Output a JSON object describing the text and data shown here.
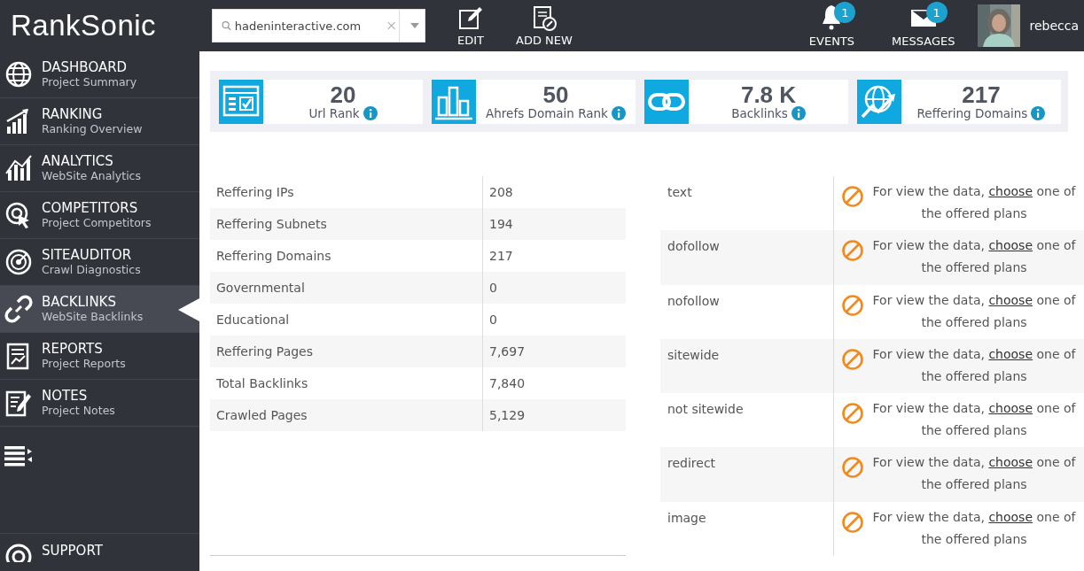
{
  "logo": {
    "text": "RankSonic"
  },
  "search": {
    "value": "hadeninteractive.com"
  },
  "toolbar": [
    {
      "kind": "edit",
      "label": "EDIT"
    },
    {
      "kind": "add",
      "label": "ADD NEW"
    }
  ],
  "notifications": [
    {
      "kind": "events",
      "label": "EVENTS",
      "count": "1"
    },
    {
      "kind": "messages",
      "label": "MESSAGES",
      "count": "1"
    }
  ],
  "user": {
    "name": "rebecca"
  },
  "sidebar": {
    "items": [
      {
        "kind": "dashboard",
        "title": "DASHBOARD",
        "subtitle": "Project Summary",
        "selected": false
      },
      {
        "kind": "ranking",
        "title": "RANKING",
        "subtitle": "Ranking Overview",
        "selected": false
      },
      {
        "kind": "analytics",
        "title": "ANALYTICS",
        "subtitle": "WebSite Analytics",
        "selected": false
      },
      {
        "kind": "competitors",
        "title": "COMPETITORS",
        "subtitle": "Project Competitors",
        "selected": false
      },
      {
        "kind": "siteauditor",
        "title": "SITEAUDITOR",
        "subtitle": "Crawl Diagnostics",
        "selected": false
      },
      {
        "kind": "backlinks",
        "title": "BACKLINKS",
        "subtitle": "WebSite Backlinks",
        "selected": true
      },
      {
        "kind": "reports",
        "title": "REPORTS",
        "subtitle": "Project Reports",
        "selected": false
      },
      {
        "kind": "notes",
        "title": "NOTES",
        "subtitle": "Project Notes",
        "selected": false
      }
    ],
    "support": {
      "title": "SUPPORT"
    }
  },
  "stats": [
    {
      "kind": "url",
      "value": "20",
      "label": "Url Rank"
    },
    {
      "kind": "bars",
      "value": "50",
      "label": "Ahrefs Domain Rank"
    },
    {
      "kind": "link",
      "value": "7.8 K",
      "label": "Backlinks"
    },
    {
      "kind": "globe",
      "value": "217",
      "label": "Reffering Domains"
    }
  ],
  "summary_table": {
    "rows": [
      {
        "label": "Reffering IPs",
        "value": "208"
      },
      {
        "label": "Reffering Subnets",
        "value": "194"
      },
      {
        "label": "Reffering Domains",
        "value": "217"
      },
      {
        "label": "Governmental",
        "value": "0"
      },
      {
        "label": "Educational",
        "value": "0"
      },
      {
        "label": "Reffering Pages",
        "value": "7,697"
      },
      {
        "label": "Total Backlinks",
        "value": "7,840"
      },
      {
        "label": "Crawled Pages",
        "value": "5,129"
      }
    ]
  },
  "link_types_table": {
    "rows": [
      {
        "label": "text",
        "before": "For view the data, ",
        "link": "choose",
        "after": " one of the offered plans"
      },
      {
        "label": "dofollow",
        "before": "For view the data, ",
        "link": "choose",
        "after": " one of the offered plans"
      },
      {
        "label": "nofollow",
        "before": "For view the data, ",
        "link": "choose",
        "after": " one of the offered plans"
      },
      {
        "label": "sitewide",
        "before": "For view the data, ",
        "link": "choose",
        "after": " one of the offered plans"
      },
      {
        "label": "not sitewide",
        "before": "For view the data, ",
        "link": "choose",
        "after": " one of the offered plans"
      },
      {
        "label": "redirect",
        "before": "For view the data, ",
        "link": "choose",
        "after": " one of the offered plans"
      },
      {
        "label": "image",
        "before": "For view the data, ",
        "link": "choose",
        "after": " one of the offered plans"
      }
    ]
  }
}
